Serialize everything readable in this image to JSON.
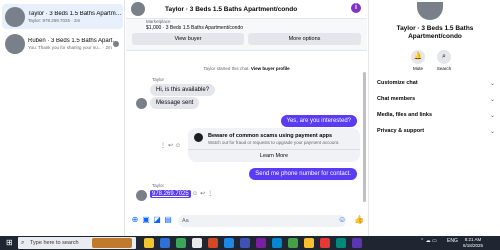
{
  "chat_list": [
    {
      "name": "Taylor · 3 Beds 1.5 Baths Apartment/condo",
      "preview": "Taylor: 978.269.7025 · 2m",
      "active": true
    },
    {
      "name": "Ruben · 3 Beds 1.5 Baths Apartment/condo",
      "preview": "You: Thank you for sharing your nu... · 2m",
      "active": false
    }
  ],
  "header": {
    "title": "Taylor · 3 Beds 1.5 Baths Apartment/condo"
  },
  "marketplace": {
    "label": "Marketplace",
    "price_line": "$1,000 · 3 Beds 1.5 Baths Apartment/condo",
    "view_buyer": "View buyer",
    "more_options": "More options"
  },
  "system_message": {
    "prefix": "Taylor started this chat.",
    "link": "View buyer profile"
  },
  "messages": {
    "sender_1": "Taylor",
    "in_1": "Hi, is this available?",
    "in_2": "Message sent",
    "out_1": "Yes, are you interested?",
    "out_2": "Send me phone number for contact.",
    "sender_2": "Taylor",
    "phone": "978.269.7025"
  },
  "scam_notice": {
    "title": "Beware of common scams using payment apps",
    "subtitle": "Watch out for fraud or requests to upgrade your payment account.",
    "button": "Learn More"
  },
  "composer": {
    "placeholder": "Aa"
  },
  "details": {
    "name": "Taylor · 3 Beds 1.5 Baths Apartment/condo",
    "mute": "Mute",
    "search": "Search",
    "sections": [
      "Customize chat",
      "Chat members",
      "Media, files and links",
      "Privacy & support"
    ]
  },
  "taskbar": {
    "search_placeholder": "Type here to search",
    "lang": "ENG",
    "time": "8:21 AM",
    "date": "6/18/2025"
  },
  "colors": {
    "accent": "#5b3cf5",
    "link": "#0866ff",
    "taskbar": "#1f2632"
  }
}
